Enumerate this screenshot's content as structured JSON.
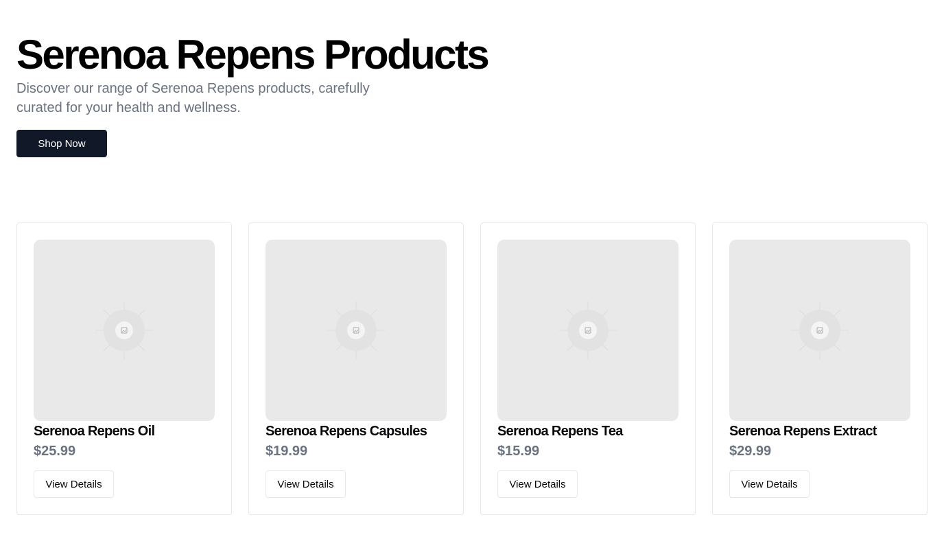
{
  "hero": {
    "title": "Serenoa Repens Products",
    "subtitle": "Discover our range of Serenoa Repens products, carefully curated for your health and wellness.",
    "cta_label": "Shop Now"
  },
  "products": [
    {
      "name": "Serenoa Repens Oil",
      "price": "$25.99",
      "button_label": "View Details",
      "image_icon": "image-placeholder-icon"
    },
    {
      "name": "Serenoa Repens Capsules",
      "price": "$19.99",
      "button_label": "View Details",
      "image_icon": "image-placeholder-icon"
    },
    {
      "name": "Serenoa Repens Tea",
      "price": "$15.99",
      "button_label": "View Details",
      "image_icon": "image-placeholder-icon"
    },
    {
      "name": "Serenoa Repens Extract",
      "price": "$29.99",
      "button_label": "View Details",
      "image_icon": "image-placeholder-icon"
    }
  ],
  "colors": {
    "primary_button": "#111827",
    "muted_text": "#6b7280",
    "image_placeholder": "#e9e9e9",
    "card_border": "#e5e7eb"
  }
}
